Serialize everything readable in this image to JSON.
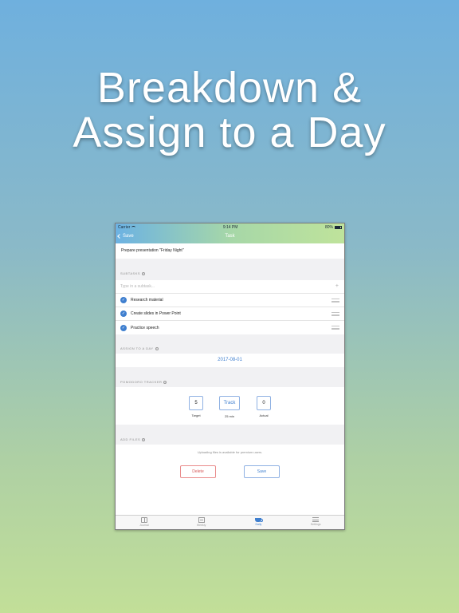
{
  "headline": {
    "line1": "Breakdown &",
    "line2": "Assign to a Day"
  },
  "statusbar": {
    "carrier": "Carrier",
    "time": "9:14 PM",
    "battery": "80%"
  },
  "navbar": {
    "back_label": "Save",
    "title": "Task"
  },
  "task": {
    "name": "Prepare presentation \"Friday Night\""
  },
  "subtasks": {
    "header": "SUBTASKS",
    "placeholder": "Type in a subtask...",
    "items": [
      {
        "label": "Research material",
        "done": true
      },
      {
        "label": "Create slides in Power Point",
        "done": true
      },
      {
        "label": "Practice speech",
        "done": true
      }
    ]
  },
  "assign": {
    "header": "ASSIGN TO A DAY",
    "date": "2017-08-01"
  },
  "pomodoro": {
    "header": "POMODORO TRACKER",
    "target_value": "5",
    "target_label": "Target",
    "track_label": "Track",
    "duration": "25 min",
    "actual_value": "0",
    "actual_label": "Actual"
  },
  "files": {
    "header": "ADD FILES",
    "note": "Uploading files is available for premium users."
  },
  "actions": {
    "delete_label": "Delete",
    "save_label": "Save"
  },
  "tabbar": {
    "items": [
      {
        "label": "Journal",
        "icon": "book-icon",
        "active": false
      },
      {
        "label": "Weekly",
        "icon": "calendar-icon",
        "active": false
      },
      {
        "label": "Daily",
        "icon": "cup-icon",
        "active": true
      },
      {
        "label": "Settings",
        "icon": "menu-icon",
        "active": false
      }
    ]
  },
  "colors": {
    "accent": "#3f7fcf",
    "danger": "#d65a5a"
  }
}
